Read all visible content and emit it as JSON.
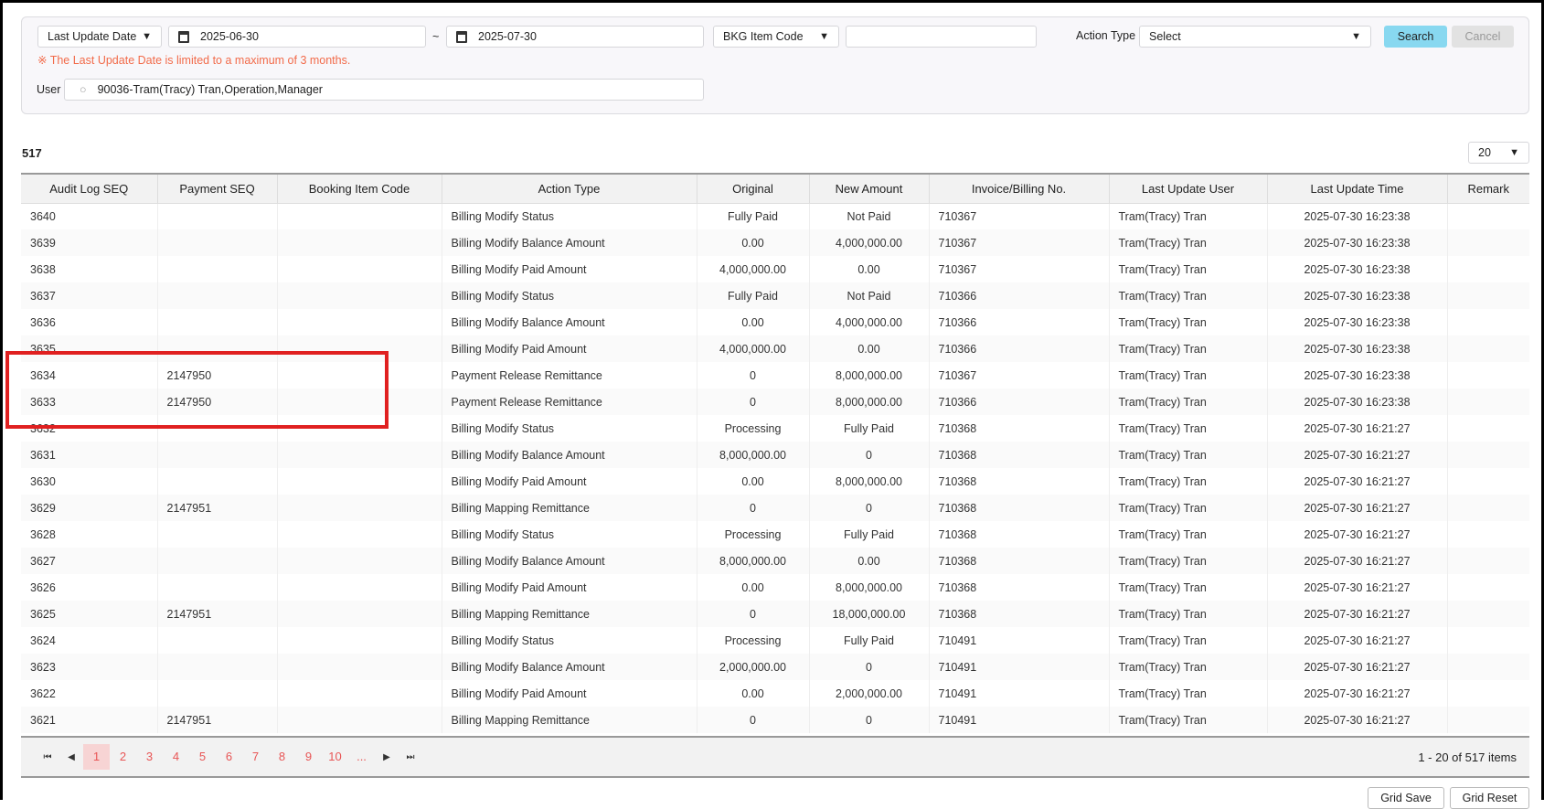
{
  "filters": {
    "date_type": "Last Update Date",
    "date_from": "2025-06-30",
    "date_sep": "~",
    "date_to": "2025-07-30",
    "code_type": "BKG Item Code",
    "code_value": "",
    "action_type_label": "Action Type",
    "action_type_value": "Select",
    "search_label": "Search",
    "cancel_label": "Cancel",
    "warning": "※ The Last Update Date is limited to a maximum of 3 months.",
    "user_label": "User",
    "user_value": "90036-Tram(Tracy) Tran,Operation,Manager"
  },
  "grid": {
    "total": "517",
    "page_size": "20",
    "columns": [
      "Audit Log SEQ",
      "Payment SEQ",
      "Booking Item Code",
      "Action Type",
      "Original",
      "New Amount",
      "Invoice/Billing No.",
      "Last Update User",
      "Last Update Time",
      "Remark"
    ],
    "rows": [
      [
        "3640",
        "",
        "",
        "Billing Modify Status",
        "Fully Paid",
        "Not Paid",
        "710367",
        "Tram(Tracy) Tran",
        "2025-07-30 16:23:38",
        ""
      ],
      [
        "3639",
        "",
        "",
        "Billing Modify Balance Amount",
        "0.00",
        "4,000,000.00",
        "710367",
        "Tram(Tracy) Tran",
        "2025-07-30 16:23:38",
        ""
      ],
      [
        "3638",
        "",
        "",
        "Billing Modify Paid Amount",
        "4,000,000.00",
        "0.00",
        "710367",
        "Tram(Tracy) Tran",
        "2025-07-30 16:23:38",
        ""
      ],
      [
        "3637",
        "",
        "",
        "Billing Modify Status",
        "Fully Paid",
        "Not Paid",
        "710366",
        "Tram(Tracy) Tran",
        "2025-07-30 16:23:38",
        ""
      ],
      [
        "3636",
        "",
        "",
        "Billing Modify Balance Amount",
        "0.00",
        "4,000,000.00",
        "710366",
        "Tram(Tracy) Tran",
        "2025-07-30 16:23:38",
        ""
      ],
      [
        "3635",
        "",
        "",
        "Billing Modify Paid Amount",
        "4,000,000.00",
        "0.00",
        "710366",
        "Tram(Tracy) Tran",
        "2025-07-30 16:23:38",
        ""
      ],
      [
        "3634",
        "2147950",
        "",
        "Payment Release Remittance",
        "0",
        "8,000,000.00",
        "710367",
        "Tram(Tracy) Tran",
        "2025-07-30 16:23:38",
        ""
      ],
      [
        "3633",
        "2147950",
        "",
        "Payment Release Remittance",
        "0",
        "8,000,000.00",
        "710366",
        "Tram(Tracy) Tran",
        "2025-07-30 16:23:38",
        ""
      ],
      [
        "3632",
        "",
        "",
        "Billing Modify Status",
        "Processing",
        "Fully Paid",
        "710368",
        "Tram(Tracy) Tran",
        "2025-07-30 16:21:27",
        ""
      ],
      [
        "3631",
        "",
        "",
        "Billing Modify Balance Amount",
        "8,000,000.00",
        "0",
        "710368",
        "Tram(Tracy) Tran",
        "2025-07-30 16:21:27",
        ""
      ],
      [
        "3630",
        "",
        "",
        "Billing Modify Paid Amount",
        "0.00",
        "8,000,000.00",
        "710368",
        "Tram(Tracy) Tran",
        "2025-07-30 16:21:27",
        ""
      ],
      [
        "3629",
        "2147951",
        "",
        "Billing Mapping Remittance",
        "0",
        "0",
        "710368",
        "Tram(Tracy) Tran",
        "2025-07-30 16:21:27",
        ""
      ],
      [
        "3628",
        "",
        "",
        "Billing Modify Status",
        "Processing",
        "Fully Paid",
        "710368",
        "Tram(Tracy) Tran",
        "2025-07-30 16:21:27",
        ""
      ],
      [
        "3627",
        "",
        "",
        "Billing Modify Balance Amount",
        "8,000,000.00",
        "0.00",
        "710368",
        "Tram(Tracy) Tran",
        "2025-07-30 16:21:27",
        ""
      ],
      [
        "3626",
        "",
        "",
        "Billing Modify Paid Amount",
        "0.00",
        "8,000,000.00",
        "710368",
        "Tram(Tracy) Tran",
        "2025-07-30 16:21:27",
        ""
      ],
      [
        "3625",
        "2147951",
        "",
        "Billing Mapping Remittance",
        "0",
        "18,000,000.00",
        "710368",
        "Tram(Tracy) Tran",
        "2025-07-30 16:21:27",
        ""
      ],
      [
        "3624",
        "",
        "",
        "Billing Modify Status",
        "Processing",
        "Fully Paid",
        "710491",
        "Tram(Tracy) Tran",
        "2025-07-30 16:21:27",
        ""
      ],
      [
        "3623",
        "",
        "",
        "Billing Modify Balance Amount",
        "2,000,000.00",
        "0",
        "710491",
        "Tram(Tracy) Tran",
        "2025-07-30 16:21:27",
        ""
      ],
      [
        "3622",
        "",
        "",
        "Billing Modify Paid Amount",
        "0.00",
        "2,000,000.00",
        "710491",
        "Tram(Tracy) Tran",
        "2025-07-30 16:21:27",
        ""
      ],
      [
        "3621",
        "2147951",
        "",
        "Billing Mapping Remittance",
        "0",
        "0",
        "710491",
        "Tram(Tracy) Tran",
        "2025-07-30 16:21:27",
        ""
      ]
    ]
  },
  "pager": {
    "pages": [
      "1",
      "2",
      "3",
      "4",
      "5",
      "6",
      "7",
      "8",
      "9",
      "10",
      "..."
    ],
    "current": "1",
    "summary": "1 - 20 of 517 items"
  },
  "footer": {
    "grid_save": "Grid Save",
    "grid_reset": "Grid Reset"
  },
  "colors": {
    "accent": "#88d8f0",
    "warning": "#f26b4a",
    "page_link": "#e85555",
    "highlight_box": "#e02020"
  }
}
